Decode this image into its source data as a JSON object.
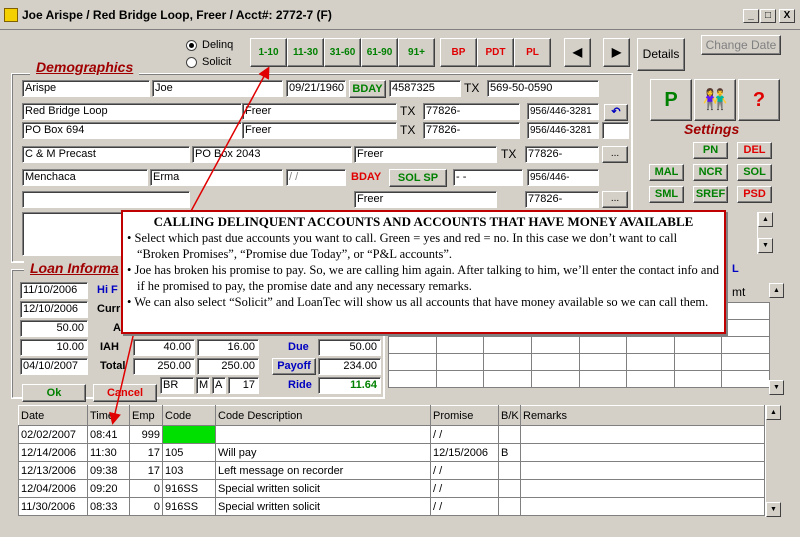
{
  "window": {
    "title": "Joe Arispe / Red Bridge Loop, Freer / Acct#: 2772-7 (F)",
    "min": "_",
    "max": "□",
    "close": "X"
  },
  "filter": {
    "delinq": "Delinq",
    "solicit": "Solicit",
    "buttons": [
      "1-10",
      "11-30",
      "31-60",
      "61-90",
      "91+",
      "BP",
      "PDT",
      "PL"
    ],
    "details": "Details",
    "change_date": "Change Date",
    "prev": "◀",
    "next": "▶"
  },
  "sections": {
    "demographics": "Demographics",
    "settings": "Settings",
    "loan": "Loan Informa"
  },
  "demo": {
    "last": "Arispe",
    "first": "Joe",
    "dob": "09/21/1960",
    "bday": "BDAY",
    "ssn": "4587325",
    "dl_state": "TX",
    "dl": "569-50-0590",
    "addr1": "Red Bridge Loop",
    "city1": "Freer",
    "st1": "TX",
    "zip1": "77826-",
    "ph1": "956/446-3281",
    "addr2": "PO Box 694",
    "city2": "Freer",
    "st2": "TX",
    "zip2": "77826-",
    "ph2": "956/446-3281",
    "emp": "C & M Precast",
    "emp_addr": "PO Box 2043",
    "emp_city": "Freer",
    "emp_st": "TX",
    "emp_zip": "77826-",
    "dots": "...",
    "ref_last": "Menchaca",
    "ref_first": "Erma",
    "ref_date": "/ /",
    "ref_bday": "BDAY",
    "solsp": "SOL SP",
    "ref_ssn": "- -",
    "ref_ph": "956/446-",
    "row6_city": "Freer",
    "row6_zip": "77826-"
  },
  "settings": {
    "p": "P",
    "people": "👫",
    "q": "?",
    "pn": "PN",
    "del": "DEL",
    "mal": "MAL",
    "ncr": "NCR",
    "sol": "SOL",
    "sml": "SML",
    "sref": "SREF",
    "psd": "PSD"
  },
  "loan": {
    "d1": "11/10/2006",
    "d2": "12/10/2006",
    "v1": "50.00",
    "v2": "10.00",
    "d3": "04/10/2007",
    "hi": "Hi F",
    "curr": "Curr",
    "a": "A",
    "iah": "IAH",
    "total": "Total",
    "iah_a": "40.00",
    "iah_b": "16.00",
    "tot_a": "250.00",
    "tot_b": "250.00",
    "br": "BR",
    "m": "M",
    "a2": "A",
    "n17": "17",
    "due": "Due",
    "due_v": "50.00",
    "payoff": "Payoff",
    "payoff_v": "234.00",
    "ride": "Ride",
    "ride_v": "11.64",
    "amt": "mt",
    "l": "L"
  },
  "actions": {
    "ok": "Ok",
    "cancel": "Cancel"
  },
  "callout": {
    "heading": "CALLING DELINQUENT ACCOUNTS AND ACCOUNTS THAT HAVE MONEY AVAILABLE",
    "b1": "Select which past due accounts you want to call. Green = yes and red = no. In this case we don’t want to call “Broken Promises”, “Promise due Today”, or “P&L accounts”.",
    "b2": "Joe has broken his promise to pay. So, we are calling him again. After talking to him, we’ll enter the contact info and if he promised to pay, the promise date and any necessary remarks.",
    "b3": "We can also select “Solicit” and LoanTec will show us all accounts that have money available so we can call them."
  },
  "log": {
    "headers": [
      "Date",
      "Time",
      "Emp",
      "Code",
      "Code Description",
      "Promise",
      "B/K",
      "Remarks"
    ],
    "rows": [
      [
        "02/02/2007",
        "08:41",
        "999",
        "",
        "",
        "/ /",
        "",
        ""
      ],
      [
        "12/14/2006",
        "11:30",
        "17",
        "105",
        "Will pay",
        "12/15/2006",
        "B",
        ""
      ],
      [
        "12/13/2006",
        "09:38",
        "17",
        "103",
        "Left message on recorder",
        "/ /",
        "",
        ""
      ],
      [
        "12/04/2006",
        "09:20",
        "0",
        "916SS",
        "Special written solicit",
        "/ /",
        "",
        ""
      ],
      [
        "11/30/2006",
        "08:33",
        "0",
        "916SS",
        "Special written solicit",
        "/ /",
        "",
        ""
      ]
    ]
  },
  "colors": {
    "green": "#008000",
    "red": "#e00000",
    "code_green": "#00e000",
    "accent": "#a00000"
  }
}
